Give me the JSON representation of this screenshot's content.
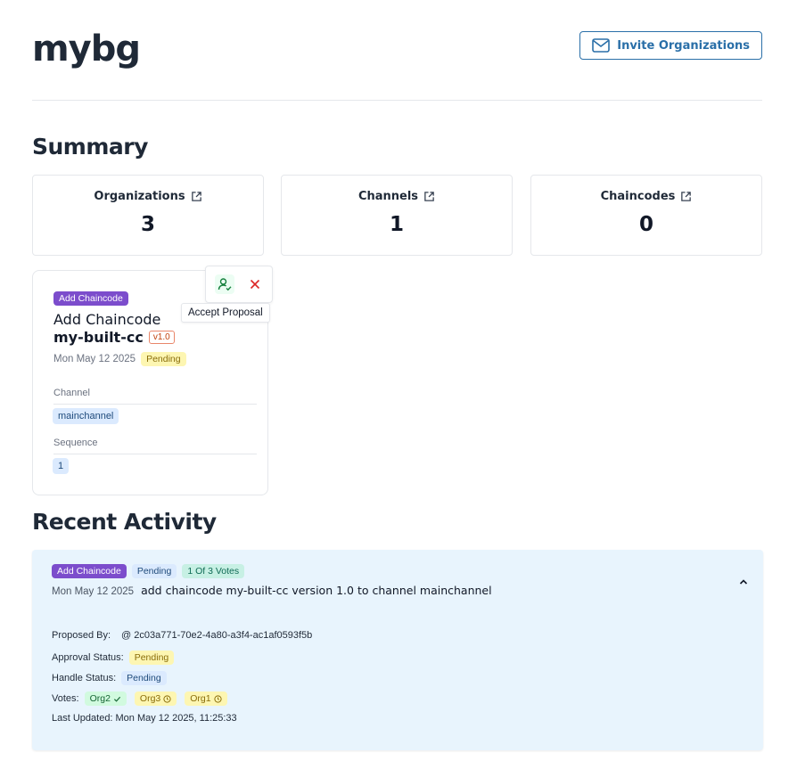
{
  "header": {
    "title": "mybg",
    "invite_label": "Invite Organizations"
  },
  "summary": {
    "heading": "Summary",
    "cards": [
      {
        "label": "Organizations",
        "value": "3"
      },
      {
        "label": "Channels",
        "value": "1"
      },
      {
        "label": "Chaincodes",
        "value": "0"
      }
    ]
  },
  "proposal": {
    "type_badge": "Add Chaincode",
    "title": "Add Chaincode",
    "name": "my-built-cc",
    "version": "v1.0",
    "date": "Mon May 12 2025",
    "status": "Pending",
    "channel_label": "Channel",
    "channel_value": "mainchannel",
    "sequence_label": "Sequence",
    "sequence_value": "1",
    "accept_tooltip": "Accept Proposal"
  },
  "activity": {
    "heading": "Recent Activity",
    "item": {
      "type_badge": "Add Chaincode",
      "status_badge": "Pending",
      "votes_badge": "1 Of 3 Votes",
      "date": "Mon May 12 2025",
      "description": "add chaincode my-built-cc version 1.0 to channel mainchannel",
      "proposed_by_label": "Proposed By:",
      "proposed_by_value": "@ 2c03a771-70e2-4a80-a3f4-ac1af0593f5b",
      "approval_label": "Approval Status:",
      "approval_value": "Pending",
      "handle_label": "Handle Status:",
      "handle_value": "Pending",
      "votes_label": "Votes:",
      "votes": [
        {
          "org": "Org2",
          "state": "approved"
        },
        {
          "org": "Org3",
          "state": "pending"
        },
        {
          "org": "Org1",
          "state": "pending"
        }
      ],
      "last_updated_label": "Last Updated:",
      "last_updated_value": "Mon May 12 2025, 11:25:33"
    }
  },
  "colors": {
    "accent": "#2a6fa8",
    "activity_bg": "#e8f4fd",
    "badge_purple": "#7c4dcc",
    "badge_pending": "#fdf6b2"
  }
}
